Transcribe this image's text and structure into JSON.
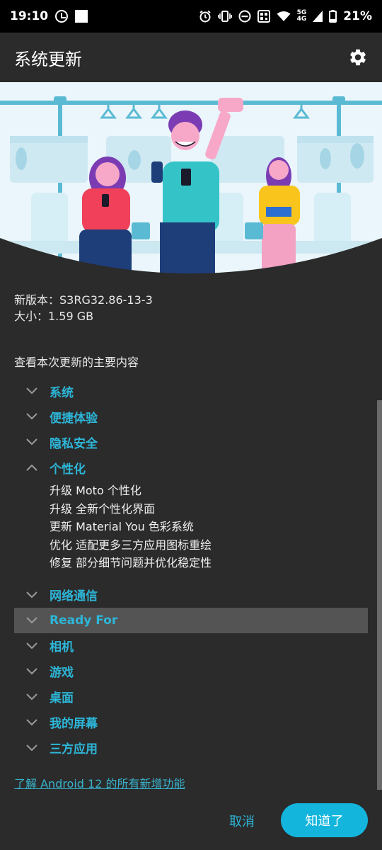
{
  "status_bar": {
    "time": "19:10",
    "network": "5G",
    "network2": "4G",
    "battery": "21%",
    "icons": [
      "alarm-clock-icon",
      "square-icon",
      "alarm-icon",
      "vibrate-icon",
      "dnd-icon",
      "nfc-icon",
      "wifi-icon",
      "signal-icon",
      "battery-icon"
    ]
  },
  "app_bar": {
    "title": "系统更新",
    "settings_icon": "gear-icon"
  },
  "info": {
    "version_label": "新版本：S3RG32.86-13-3",
    "size_label": "大小：1.59 GB"
  },
  "summary_title": "查看本次更新的主要内容",
  "sections": [
    {
      "label": "系统",
      "expanded": false
    },
    {
      "label": "便捷体验",
      "expanded": false
    },
    {
      "label": "隐私安全",
      "expanded": false
    },
    {
      "label": "个性化",
      "expanded": true,
      "details": [
        "升级 Moto 个性化",
        "升级 全新个性化界面",
        "更新 Material You 色彩系统",
        "优化 适配更多三方应用图标重绘",
        "修复 部分细节问题并优化稳定性"
      ]
    },
    {
      "label": "网络通信",
      "expanded": false
    },
    {
      "label": "Ready For",
      "expanded": false,
      "highlighted": true
    },
    {
      "label": "相机",
      "expanded": false
    },
    {
      "label": "游戏",
      "expanded": false
    },
    {
      "label": "桌面",
      "expanded": false
    },
    {
      "label": "我的屏幕",
      "expanded": false
    },
    {
      "label": "三方应用",
      "expanded": false
    }
  ],
  "learn_more_link": "了解 Android 12 的所有新增功能",
  "buttons": {
    "cancel": "取消",
    "ok": "知道了"
  },
  "colors": {
    "background": "#2b2b2b",
    "accent": "#2db6d8",
    "primary_button": "#14b5dd",
    "highlight_row": "#545454"
  }
}
